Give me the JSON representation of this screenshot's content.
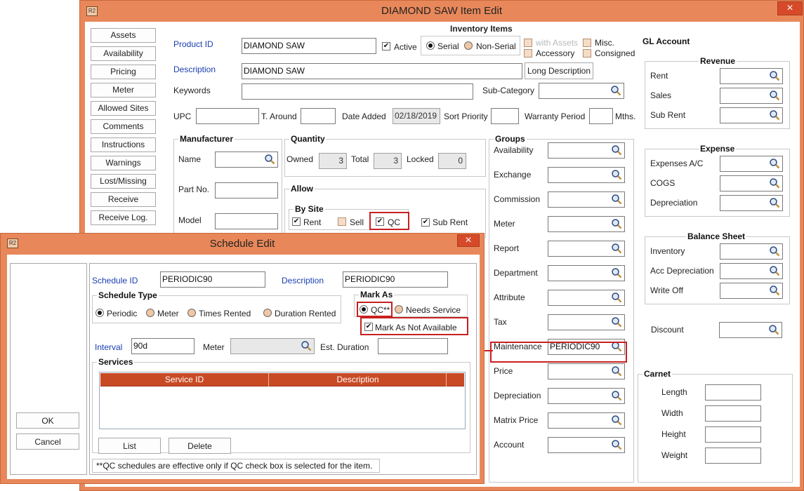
{
  "item_window": {
    "title": "DIAMOND SAW Item Edit",
    "app_icon": "R2",
    "close_glyph": "×"
  },
  "nav": [
    "Assets",
    "Availability",
    "Pricing",
    "Meter",
    "Allowed Sites",
    "Comments",
    "Instructions",
    "Warnings",
    "Lost/Missing",
    "Receive",
    "Receive Log."
  ],
  "item": {
    "product_id_label": "Product ID",
    "product_id": "DIAMOND SAW",
    "description_label": "Description",
    "description": "DIAMOND SAW",
    "keywords_label": "Keywords",
    "subcategory_label": "Sub-Category",
    "active_label": "Active",
    "inventory_items_label": "Inventory Items",
    "serial_label": "Serial",
    "nonserial_label": "Non-Serial",
    "with_assets_label": "with Assets",
    "accessory_label": "Accessory",
    "misc_label": "Misc.",
    "consigned_label": "Consigned",
    "long_description_btn": "Long Description",
    "upc_label": "UPC",
    "taround_label": "T. Around",
    "date_added_label": "Date Added",
    "date_added": "02/18/2019",
    "sort_priority_label": "Sort Priority",
    "warranty_label": "Warranty Period",
    "mths_label": "Mths.",
    "check_glyph": "✔"
  },
  "manufacturer": {
    "title": "Manufacturer",
    "name": "Name",
    "part_no": "Part No.",
    "model": "Model"
  },
  "quantity": {
    "title": "Quantity",
    "owned_label": "Owned",
    "owned": "3",
    "total_label": "Total",
    "total": "3",
    "locked_label": "Locked",
    "locked": "0"
  },
  "allow": {
    "title": "Allow",
    "by_site": "By Site",
    "rent": "Rent",
    "sell": "Sell",
    "qc": "QC",
    "sub_rent": "Sub Rent"
  },
  "groups": {
    "title": "Groups",
    "rows": [
      {
        "label": "Availability",
        "value": ""
      },
      {
        "label": "Exchange",
        "value": ""
      },
      {
        "label": "Commission",
        "value": ""
      },
      {
        "label": "Meter",
        "value": ""
      },
      {
        "label": "Report",
        "value": ""
      },
      {
        "label": "Department",
        "value": ""
      },
      {
        "label": "Attribute",
        "value": ""
      },
      {
        "label": "Tax",
        "value": ""
      },
      {
        "label": "Maintenance",
        "value": "PERIODIC90"
      },
      {
        "label": "Price",
        "value": ""
      },
      {
        "label": "Depreciation",
        "value": ""
      },
      {
        "label": "Matrix Price",
        "value": ""
      },
      {
        "label": "Account",
        "value": ""
      }
    ]
  },
  "gl": {
    "title": "GL Account",
    "revenue": {
      "title": "Revenue",
      "rows": [
        "Rent",
        "Sales",
        "Sub Rent"
      ]
    },
    "expense": {
      "title": "Expense",
      "rows": [
        "Expenses A/C",
        "COGS",
        "Depreciation"
      ]
    },
    "balance": {
      "title": "Balance Sheet",
      "rows": [
        "Inventory",
        "Acc Depreciation",
        "Write Off"
      ]
    },
    "discount": "Discount"
  },
  "carnet": {
    "title": "Carnet",
    "rows": [
      "Length",
      "Width",
      "Height",
      "Weight"
    ]
  },
  "schedule": {
    "title": "Schedule Edit",
    "app_icon": "R2",
    "close_glyph": "×",
    "ok": "OK",
    "cancel": "Cancel",
    "schedule_id_label": "Schedule ID",
    "schedule_id": "PERIODIC90",
    "description_label": "Description",
    "description": "PERIODIC90",
    "type_title": "Schedule Type",
    "types": [
      "Periodic",
      "Meter",
      "Times Rented",
      "Duration Rented"
    ],
    "mark_title": "Mark As",
    "qc_label": "QC**",
    "needs_service": "Needs Service",
    "not_available": "Mark As Not Available",
    "interval_label": "Interval",
    "interval": "90d",
    "meter_label": "Meter",
    "est_label": "Est. Duration",
    "services_title": "Services",
    "columns": [
      "Service ID",
      "Description"
    ],
    "list_btn": "List",
    "delete_btn": "Delete",
    "footnote": "**QC schedules are effective only if QC check box is selected for the item."
  }
}
